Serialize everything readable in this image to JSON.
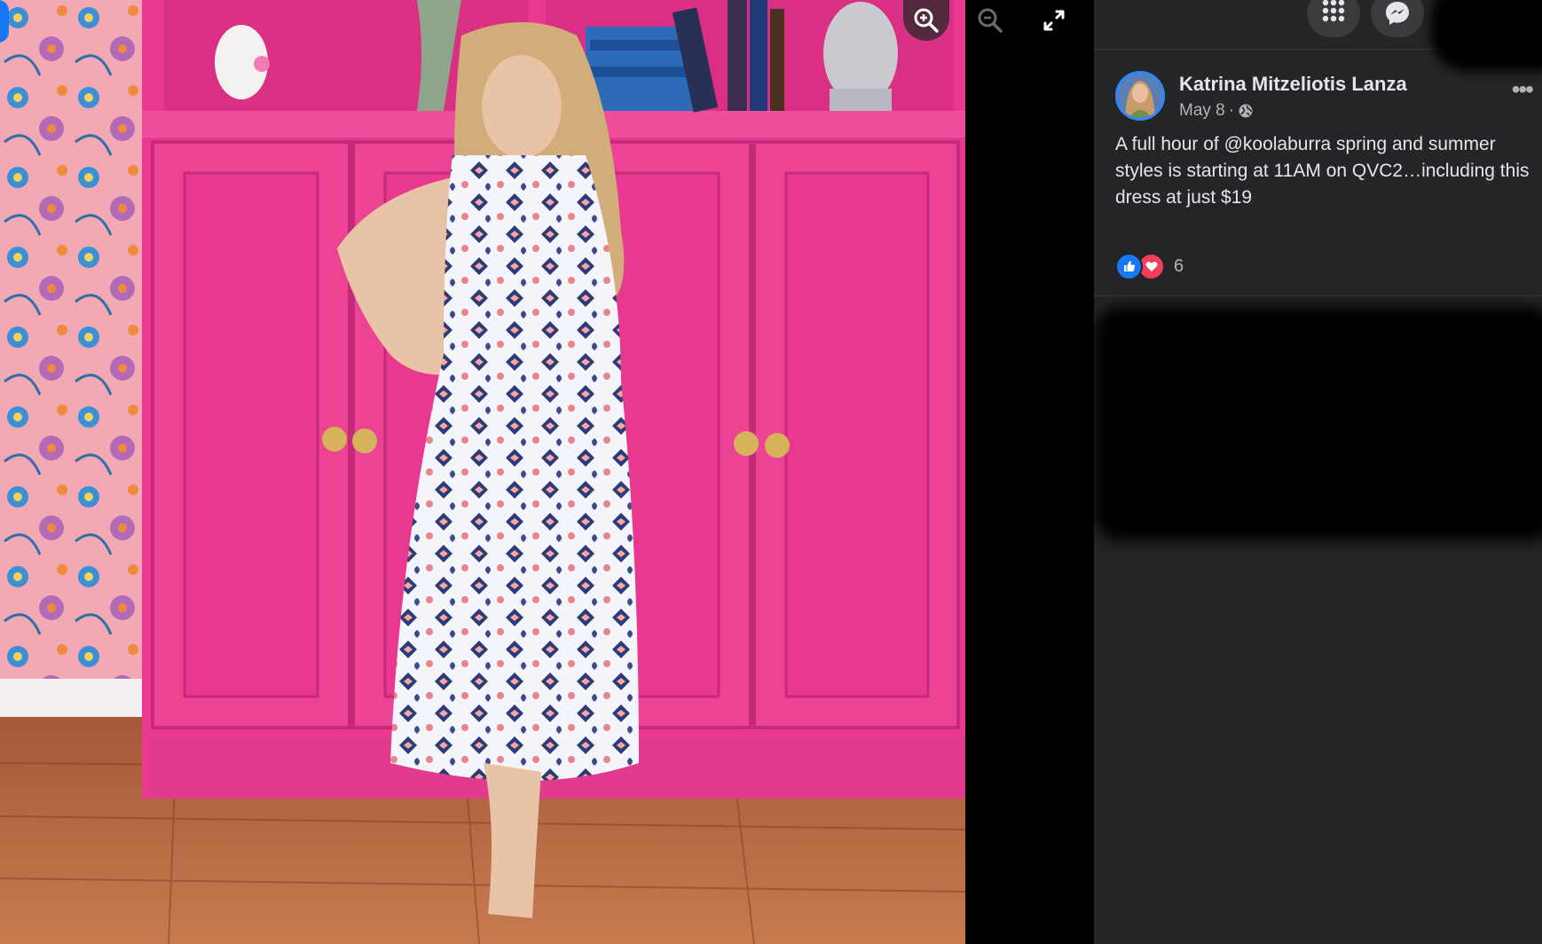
{
  "viewer": {
    "toolbar": {
      "zoom_in_icon": "zoom-in-icon",
      "zoom_out_icon": "zoom-out-icon",
      "fullscreen_icon": "fullscreen-icon"
    }
  },
  "topbar": {
    "menu_icon": "grid-menu-icon",
    "messenger_icon": "messenger-icon"
  },
  "post": {
    "author": "Katrina Mitzeliotis Lanza",
    "date": "May 8",
    "separator": "·",
    "privacy_icon": "globe-icon",
    "more_label": "•••",
    "text": "A full hour of @koolaburra spring and summer styles is starting at 11AM on QVC2…including this dress at just $19",
    "reactions": {
      "types": [
        "like",
        "love"
      ],
      "count": "6"
    }
  },
  "colors": {
    "panel_bg": "#242526",
    "text_primary": "#e4e6eb",
    "text_secondary": "#b0b3b8",
    "accent_blue": "#1877f2",
    "love_red": "#f33e58",
    "cabinet_pink": "#e8388f"
  }
}
